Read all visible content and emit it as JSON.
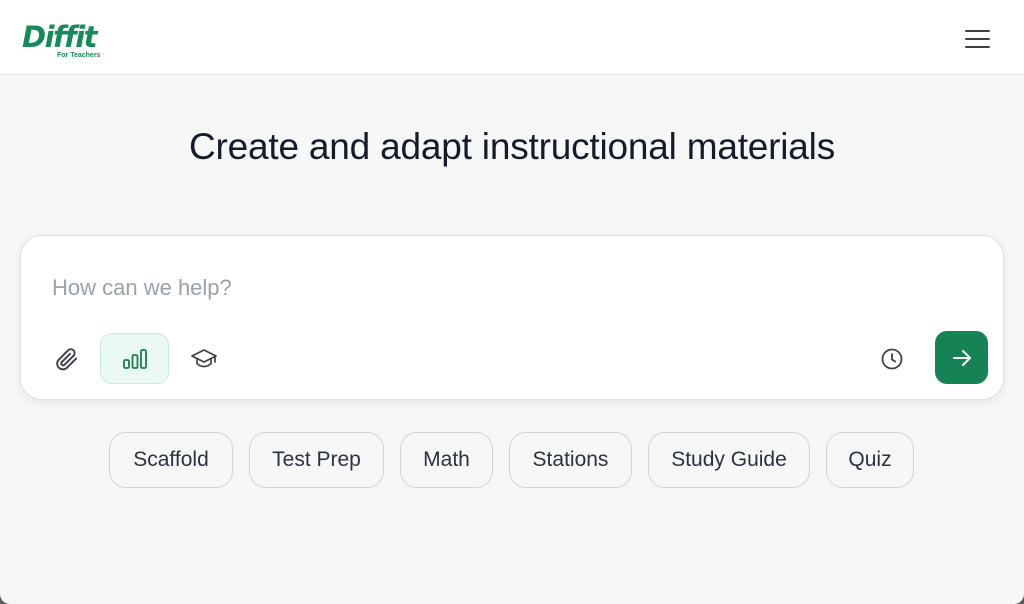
{
  "header": {
    "logo_text": "Diffit",
    "logo_subtitle": "For Teachers",
    "menu_icon": "hamburger-menu-icon"
  },
  "main": {
    "title": "Create and adapt instructional materials"
  },
  "prompt": {
    "placeholder": "How can we help?",
    "value": "",
    "tools": {
      "attach_icon": "paperclip-icon",
      "level_icon": "bar-chart-icon",
      "grade_icon": "graduation-cap-icon",
      "history_icon": "clock-icon",
      "send_icon": "arrow-right-icon"
    }
  },
  "chips": [
    "Scaffold",
    "Test Prep",
    "Math",
    "Stations",
    "Study Guide",
    "Quiz"
  ],
  "colors": {
    "brand": "#178a5a",
    "send_button": "#168357",
    "active_tool_bg": "#eafaf2",
    "page_bg": "#f6f7f7",
    "title_text": "#141c2b",
    "placeholder_text": "#9aa1a9"
  }
}
